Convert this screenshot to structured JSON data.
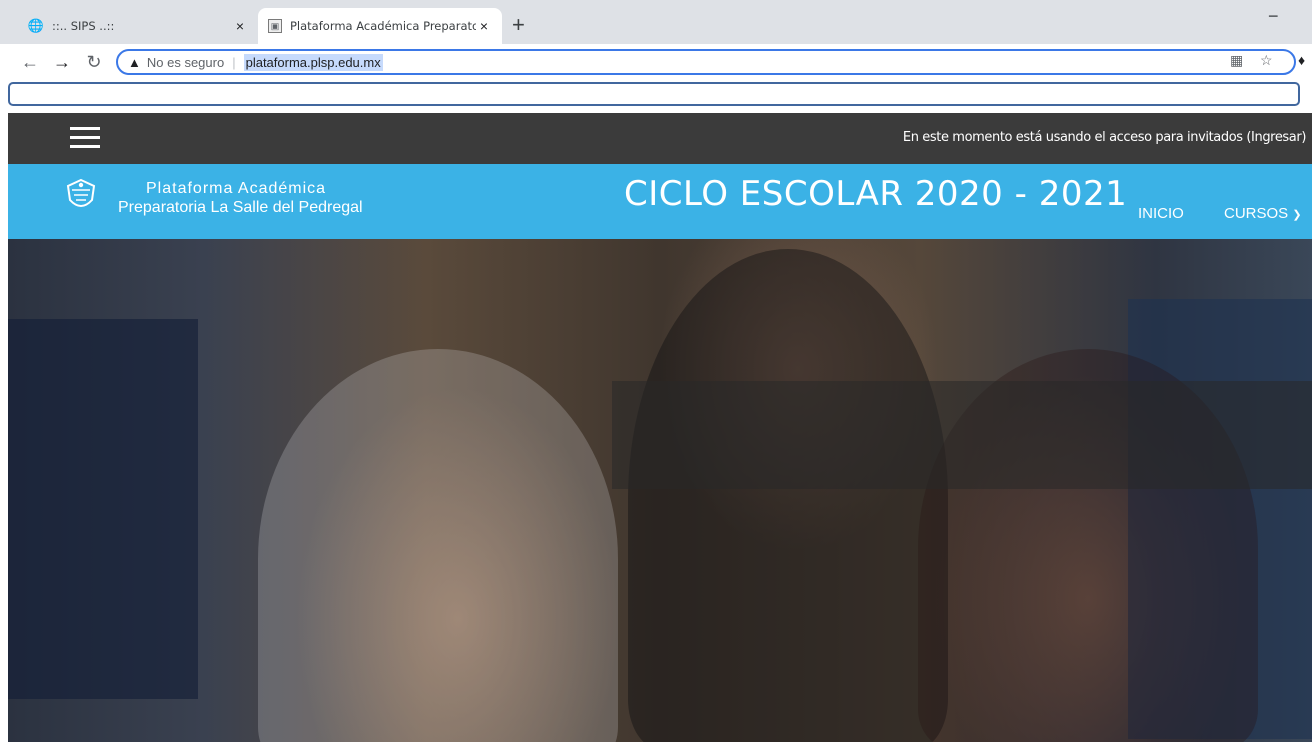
{
  "browser": {
    "tabs": [
      {
        "title": "::.. SIPS ..::",
        "active": false
      },
      {
        "title": "Plataforma Académica Preparato",
        "active": true
      }
    ],
    "new_tab_symbol": "+",
    "minimize_symbol": "−",
    "close_symbol": "×",
    "security_label": "No es seguro",
    "url": "plataforma.plsp.edu.mx",
    "find_value": ""
  },
  "site": {
    "topbar": {
      "guest_notice": "En este momento está usando el acceso para invitados (Ingresar)"
    },
    "header": {
      "brand_line1": "Plataforma Académica",
      "brand_line2": "Preparatoria La Salle del Pedregal",
      "nav": [
        {
          "label": "INICIO"
        },
        {
          "label": "CURSOS"
        }
      ]
    },
    "hero": {
      "title": "CICLO ESCOLAR 2020 - 2021"
    }
  },
  "colors": {
    "topbar": "#3b3b3b",
    "header": "#3bb2e6",
    "omnibox_focus": "#3b78e7"
  }
}
